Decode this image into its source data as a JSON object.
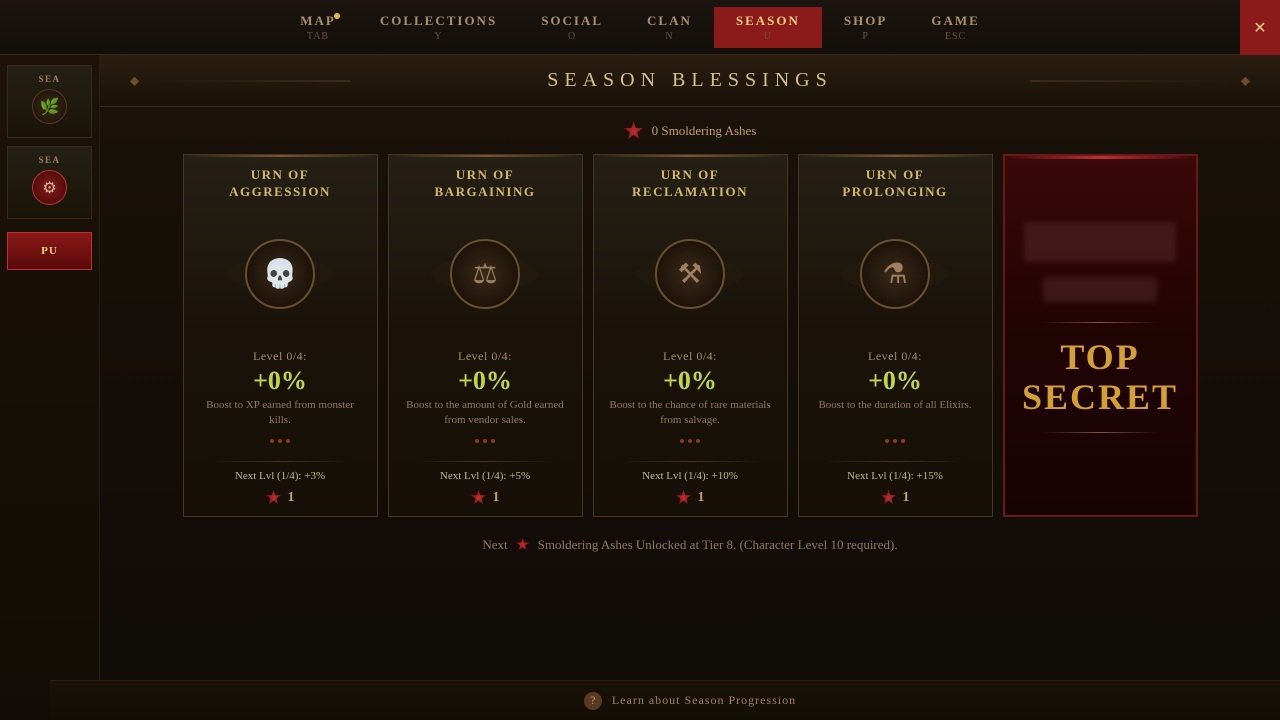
{
  "nav": {
    "items": [
      {
        "label": "MAP",
        "key": "TAB",
        "active": false,
        "hasDot": true
      },
      {
        "label": "COLLECTIONS",
        "key": "Y",
        "active": false,
        "hasDot": false
      },
      {
        "label": "SOCIAL",
        "key": "O",
        "active": false,
        "hasDot": false
      },
      {
        "label": "CLAN",
        "key": "N",
        "active": false,
        "hasDot": false
      },
      {
        "label": "SEASON",
        "key": "U",
        "active": true,
        "hasDot": false
      },
      {
        "label": "SHOP",
        "key": "P",
        "active": false,
        "hasDot": false
      },
      {
        "label": "GAME",
        "key": "ESC",
        "active": false,
        "hasDot": false
      }
    ],
    "exit_icon": "✕"
  },
  "sidebar": {
    "items": [
      {
        "label": "SEA",
        "icon": "🌿",
        "active": false
      },
      {
        "label": "SEA",
        "icon": "⚙",
        "active": true
      }
    ],
    "push_label": "PU"
  },
  "page": {
    "title": "SEASON BLESSINGS",
    "ashes_count": "0",
    "ashes_label": "Smoldering Ashes"
  },
  "cards": [
    {
      "title": "URN OF\nAGGRESSION",
      "symbol": "💀",
      "level": "Level 0/4:",
      "bonus": "+0%",
      "desc": "Boost to XP earned from monster kills.",
      "next_lvl": "Next Lvl (1/4): +3%",
      "cost": "1"
    },
    {
      "title": "URN OF\nBARGAINING",
      "symbol": "⚖",
      "level": "Level 0/4:",
      "bonus": "+0%",
      "desc": "Boost to the amount of Gold earned from vendor sales.",
      "next_lvl": "Next Lvl (1/4): +5%",
      "cost": "1"
    },
    {
      "title": "URN OF\nRECLAMATION",
      "symbol": "⚒",
      "level": "Level 0/4:",
      "bonus": "+0%",
      "desc": "Boost to the chance of rare materials from salvage.",
      "next_lvl": "Next Lvl (1/4): +10%",
      "cost": "1"
    },
    {
      "title": "URN OF\nPROLONGING",
      "symbol": "⚗",
      "level": "Level 0/4:",
      "bonus": "+0%",
      "desc": "Boost to the duration of all Elixirs.",
      "next_lvl": "Next Lvl (1/4): +15%",
      "cost": "1"
    }
  ],
  "secret_card": {
    "title": "TOP\nSECRET"
  },
  "footer": {
    "next_label": "Next",
    "ashes_unlock": "Smoldering Ashes Unlocked at Tier 8. (Character Level 10 required).",
    "help_label": "Learn about Season Progression"
  }
}
